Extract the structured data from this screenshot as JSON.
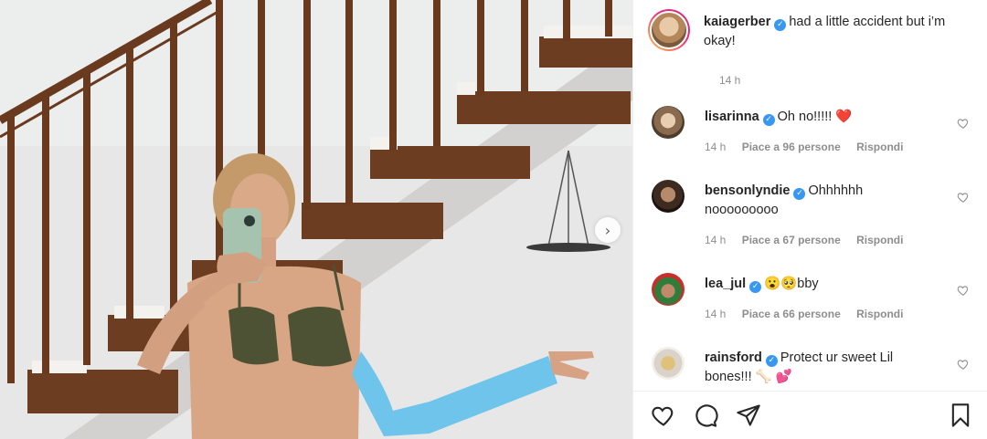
{
  "post": {
    "next_glyph": "›",
    "carousel_next_icon": "chevron-right-icon"
  },
  "caption": {
    "username": "kaiagerber",
    "text": "had a little accident but i’m okay!",
    "time": "14 h",
    "verified_glyph": "✓"
  },
  "comments": [
    {
      "username": "lisarinna",
      "text": "Oh no!!!!! ❤️",
      "time": "14 h",
      "likes": "Piace a 96 persone",
      "reply": "Rispondi"
    },
    {
      "username": "bensonlyndie",
      "text": "Ohhhhhh nooooooooo",
      "time": "14 h",
      "likes": "Piace a 67 persone",
      "reply": "Rispondi"
    },
    {
      "username": "lea_jul",
      "text": "😮🥺bby",
      "time": "14 h",
      "likes": "Piace a 66 persone",
      "reply": "Rispondi"
    },
    {
      "username": "rainsford",
      "text": "Protect ur sweet Lil bones!!! 🦴 💕",
      "time": "",
      "likes": "",
      "reply": ""
    }
  ],
  "icons": {
    "like": "heart-icon",
    "comment": "comment-icon",
    "share": "paper-plane-icon",
    "save": "bookmark-icon"
  },
  "colors": {
    "verified": "#3897f0",
    "muted": "#8e8e8e",
    "text": "#262626",
    "cast": "#6ec4ea"
  }
}
